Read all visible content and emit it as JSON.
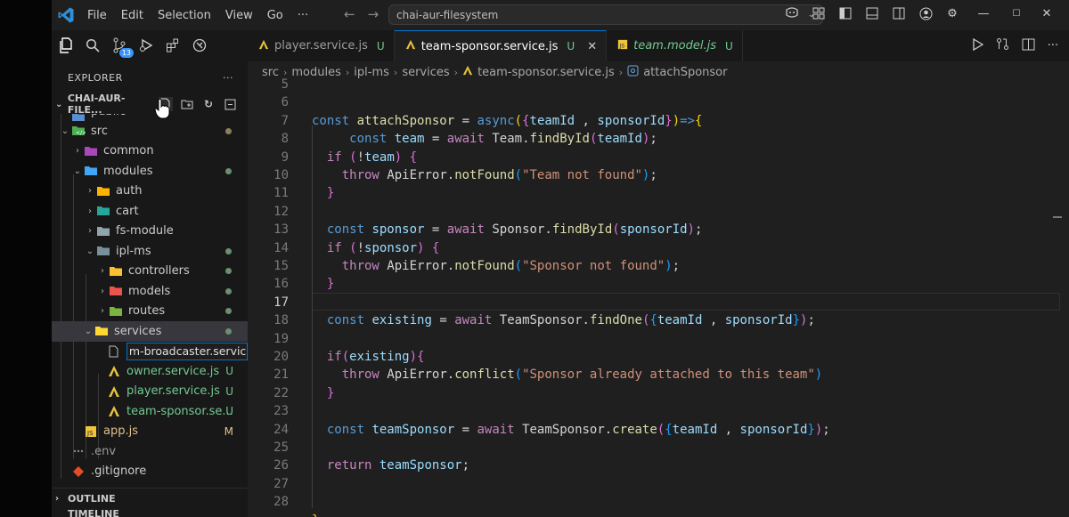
{
  "titlebar": {
    "menu": [
      "File",
      "Edit",
      "Selection",
      "View",
      "Go",
      "···"
    ],
    "search_text": "chai-aur-filesystem"
  },
  "activity": {
    "badge": "13"
  },
  "explorer": {
    "title": "EXPLORER",
    "more": "···",
    "root": "CHAI-AUR-FILE...",
    "items": [
      {
        "label": "public"
      },
      {
        "label": "src"
      },
      {
        "label": "common"
      },
      {
        "label": "modules"
      },
      {
        "label": "auth"
      },
      {
        "label": "cart"
      },
      {
        "label": "fs-module"
      },
      {
        "label": "ipl-ms"
      },
      {
        "label": "controllers"
      },
      {
        "label": "models"
      },
      {
        "label": "routes"
      },
      {
        "label": "services"
      },
      {
        "label": "m-broadcaster.serviced"
      },
      {
        "label": "owner.service.js",
        "status": "U"
      },
      {
        "label": "player.service.js",
        "status": "U"
      },
      {
        "label": "team-sponsor.se...",
        "status": "U"
      },
      {
        "label": "app.js",
        "status": "M"
      },
      {
        "label": ".env"
      },
      {
        "label": ".gitignore"
      }
    ],
    "outline": "OUTLINE",
    "timeline": "TIMELINE"
  },
  "tabs": [
    {
      "label": "player.service.js",
      "status": "U"
    },
    {
      "label": "team-sponsor.service.js",
      "status": "U"
    },
    {
      "label": "team.model.js",
      "status": "U"
    }
  ],
  "breadcrumbs": [
    "src",
    "modules",
    "ipl-ms",
    "services",
    "team-sponsor.service.js",
    "attachSponsor"
  ],
  "editor": {
    "line_numbers": [
      "5",
      "6",
      "7",
      "8",
      "9",
      "10",
      "11",
      "12",
      "13",
      "14",
      "15",
      "16",
      "17",
      "18",
      "19",
      "20",
      "21",
      "22",
      "23",
      "24",
      "25",
      "26",
      "27",
      "28"
    ]
  },
  "colors": {
    "accent": "#0078d4",
    "untracked": "#73c991",
    "modified": "#e2c08d"
  }
}
